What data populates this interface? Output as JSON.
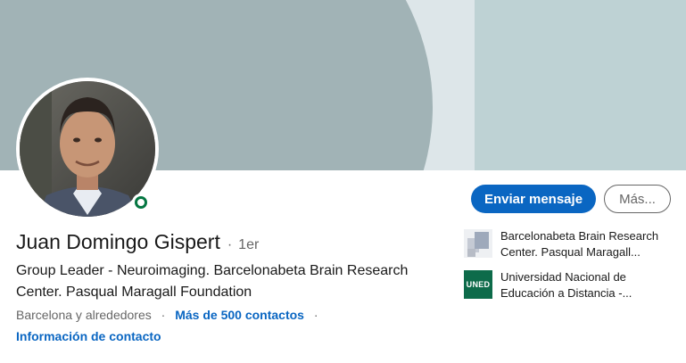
{
  "profile": {
    "name": "Juan Domingo Gispert",
    "separator": "·",
    "degree": "1er",
    "headline": "Group Leader - Neuroimaging. Barcelonabeta Brain Research Center. Pasqual Maragall Foundation",
    "location": "Barcelona y alrededores",
    "meta_separator": "·",
    "connections": "Más de 500 contactos",
    "contact_info": "Información de contacto",
    "status": "online"
  },
  "actions": {
    "message_label": "Enviar mensaje",
    "more_label": "Más..."
  },
  "organizations": [
    {
      "name": "Barcelonabeta Brain Research Center. Pasqual Maragall...",
      "logo": "barcelonabeta-logo"
    },
    {
      "name": "Universidad Nacional de Educación a Distancia -...",
      "logo": "uned-logo",
      "logo_text": "UNED"
    }
  ],
  "colors": {
    "primary": "#0a66c2",
    "online": "#057642",
    "banner_shape": "#a1b3b6",
    "banner_bg": "#dde6e9",
    "banner_panel": "#bed2d4"
  }
}
